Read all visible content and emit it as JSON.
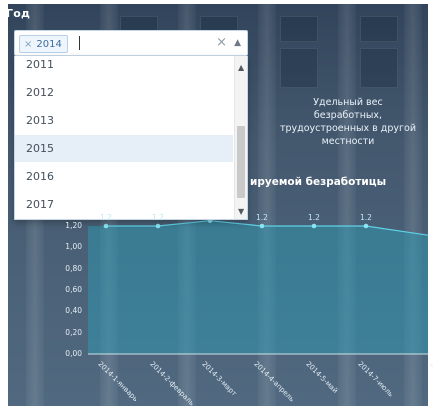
{
  "filter": {
    "label": "Год",
    "selected_tags": [
      "2014"
    ],
    "remove_tag_glyph": "×",
    "clear_glyph": "×",
    "toggle_glyph": "▲"
  },
  "dropdown": {
    "options": [
      "2011",
      "2012",
      "2013",
      "2015",
      "2016",
      "2017"
    ],
    "highlighted_index": 3,
    "scroll_up_glyph": "▲",
    "scroll_down_glyph": "▼"
  },
  "chart_text": {
    "annotation_lines": [
      "Удельный вес",
      "безработных,",
      "трудоустроенных в другой",
      "местности"
    ],
    "title_fragment": "ируемой безработицы"
  },
  "chart_data": {
    "type": "area",
    "title": "",
    "xlabel": "",
    "ylabel": "",
    "ylim": [
      0,
      1.2
    ],
    "yticks": [
      "0,00",
      "0,20",
      "0,40",
      "0,60",
      "0,80",
      "1,00",
      "1,20"
    ],
    "categories": [
      "2014-1-январь",
      "2014-2-февраль",
      "2014-3-март",
      "2014-4-апрель",
      "2014-5-май",
      "2014-7-июль",
      "2014-8"
    ],
    "point_labels": [
      "1.2",
      "1.2",
      "",
      "1.2",
      "1.2",
      "1.2",
      "1.1"
    ],
    "values": [
      1.2,
      1.2,
      1.25,
      1.2,
      1.2,
      1.2,
      1.1
    ],
    "colors": {
      "area": "#2aa0b8",
      "line": "#5fd1e6",
      "marker": "#8be4f2"
    }
  }
}
